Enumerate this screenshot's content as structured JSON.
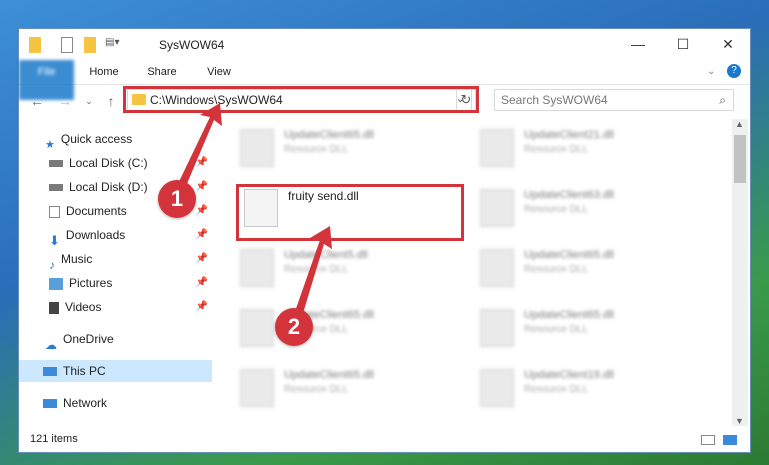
{
  "window": {
    "title": "SysWOW64",
    "controls": {
      "minimize": "—",
      "maximize": "☐",
      "close": "✕"
    }
  },
  "ribbon": {
    "tabs": [
      {
        "label": "File"
      },
      {
        "label": "Home"
      },
      {
        "label": "Share"
      },
      {
        "label": "View"
      }
    ]
  },
  "nav": {
    "address": "C:\\Windows\\SysWOW64",
    "search_placeholder": "Search SysWOW64"
  },
  "sidebar": {
    "items": [
      {
        "label": "Quick access"
      },
      {
        "label": "Local Disk (C:)"
      },
      {
        "label": "Local Disk (D:)"
      },
      {
        "label": "Documents"
      },
      {
        "label": "Downloads"
      },
      {
        "label": "Music"
      },
      {
        "label": "Pictures"
      },
      {
        "label": "Videos"
      },
      {
        "label": "OneDrive"
      },
      {
        "label": "This PC"
      },
      {
        "label": "Network"
      }
    ]
  },
  "files": [
    {
      "name": "UpdateClient65.dll",
      "type": "Resource DLL"
    },
    {
      "name": "UpdateClient21.dll",
      "type": "Resource DLL"
    },
    {
      "name": "fruity send.dll",
      "type": ""
    },
    {
      "name": "UpdateClient63.dll",
      "type": "Resource DLL"
    },
    {
      "name": "UpdateClient5.dll",
      "type": "Resource DLL"
    },
    {
      "name": "UpdateClient65.dll",
      "type": "Resource DLL"
    },
    {
      "name": "UpdateClient65.dll",
      "type": "Resource DLL"
    },
    {
      "name": "UpdateClient65.dll",
      "type": "Resource DLL"
    },
    {
      "name": "UpdateClient65.dll",
      "type": "Resource DLL"
    },
    {
      "name": "UpdateClient19.dll",
      "type": "Resource DLL"
    }
  ],
  "status": {
    "item_count": "121 items"
  },
  "annotations": {
    "step1": "1",
    "step2": "2",
    "color": "#d3333a"
  },
  "colors": {
    "file_tab": "#1979ca",
    "selected": "#cce8ff"
  }
}
